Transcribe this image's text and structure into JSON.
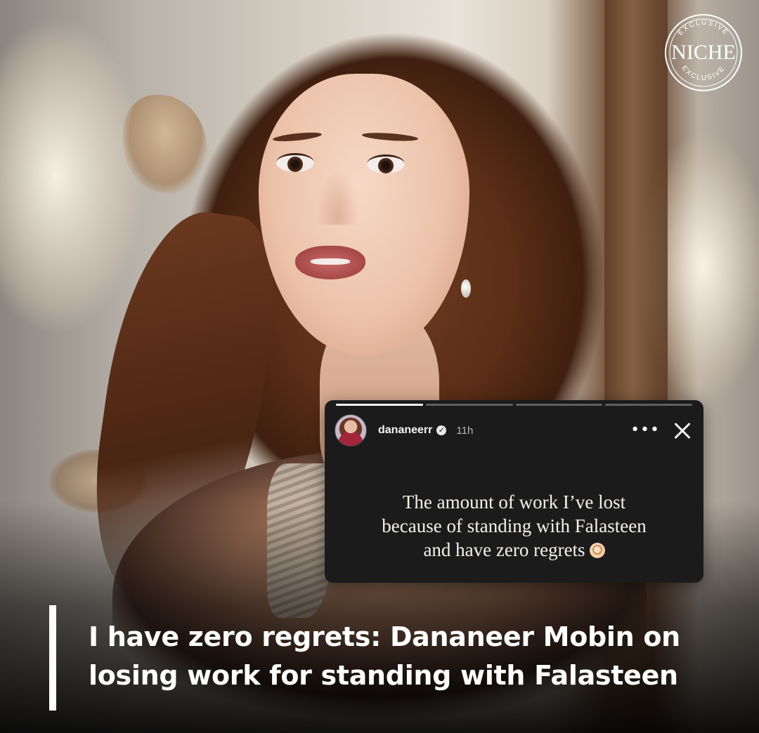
{
  "badge": {
    "top_text": "EXCLUSIVE",
    "brand": "NICHE",
    "bottom_text": "EXCLUSIVE"
  },
  "story": {
    "progress_segments": [
      1.0,
      0.0,
      0.0,
      0.0
    ],
    "username": "dananeerr",
    "verified_icon": "verified-check-icon",
    "time_ago": "11h",
    "more_icon": "more-horizontal-icon",
    "close_icon": "close-icon",
    "text_lines": [
      "The amount of work I’ve lost",
      "because of standing with Falasteen",
      "and have zero regrets"
    ],
    "emoji": "ok-hand-emoji"
  },
  "headline": {
    "line1": "I have zero regrets: Dananeer Mobin on",
    "line2": "losing work for standing with Falasteen"
  },
  "colors": {
    "story_background": "#1b1b1c",
    "headline_text": "#ffffff",
    "accent_bar": "#ffffff"
  }
}
